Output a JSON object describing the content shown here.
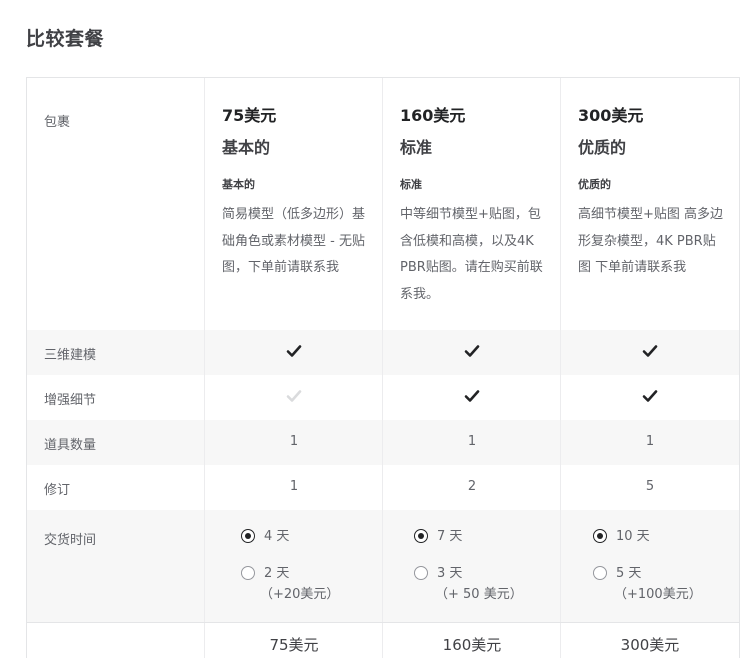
{
  "title": "比较套餐",
  "row_labels": {
    "package": "包裹",
    "modeling": "三维建模",
    "detail": "增强细节",
    "props": "道具数量",
    "revisions": "修订",
    "delivery": "交货时间"
  },
  "packages": [
    {
      "price": "75美元",
      "name": "基本的",
      "subtitle": "基本的",
      "description": "简易模型（低多边形）基础角色或素材模型 - 无贴图，下单前请联系我",
      "modeling": true,
      "detail": false,
      "props": "1",
      "revisions": "1",
      "delivery_options": [
        {
          "label": "4 天",
          "extra": "",
          "selected": true
        },
        {
          "label": "2 天",
          "extra": "（+20美元）",
          "selected": false
        }
      ],
      "footer_price": "75美元"
    },
    {
      "price": "160美元",
      "name": "标准",
      "subtitle": "标准",
      "description": "中等细节模型+贴图，包含低模和高模，以及4K PBR贴图。请在购买前联系我。",
      "modeling": true,
      "detail": true,
      "props": "1",
      "revisions": "2",
      "delivery_options": [
        {
          "label": "7 天",
          "extra": "",
          "selected": true
        },
        {
          "label": "3 天",
          "extra": "（+ 50 美元）",
          "selected": false
        }
      ],
      "footer_price": "160美元"
    },
    {
      "price": "300美元",
      "name": "优质的",
      "subtitle": "优质的",
      "description": "高细节模型+贴图 高多边形复杂模型，4K PBR贴图 下单前请联系我",
      "modeling": true,
      "detail": true,
      "props": "1",
      "revisions": "5",
      "delivery_options": [
        {
          "label": "10 天",
          "extra": "",
          "selected": true
        },
        {
          "label": "5 天",
          "extra": "（+100美元）",
          "selected": false
        }
      ],
      "footer_price": "300美元"
    }
  ],
  "colors": {
    "check_active": "#222325",
    "check_inactive": "#dadbdd",
    "shaded_row": "#f7f7f7"
  },
  "icons": {
    "included": "checkmark-icon",
    "not_included": "checkmark-icon (light gray)"
  }
}
